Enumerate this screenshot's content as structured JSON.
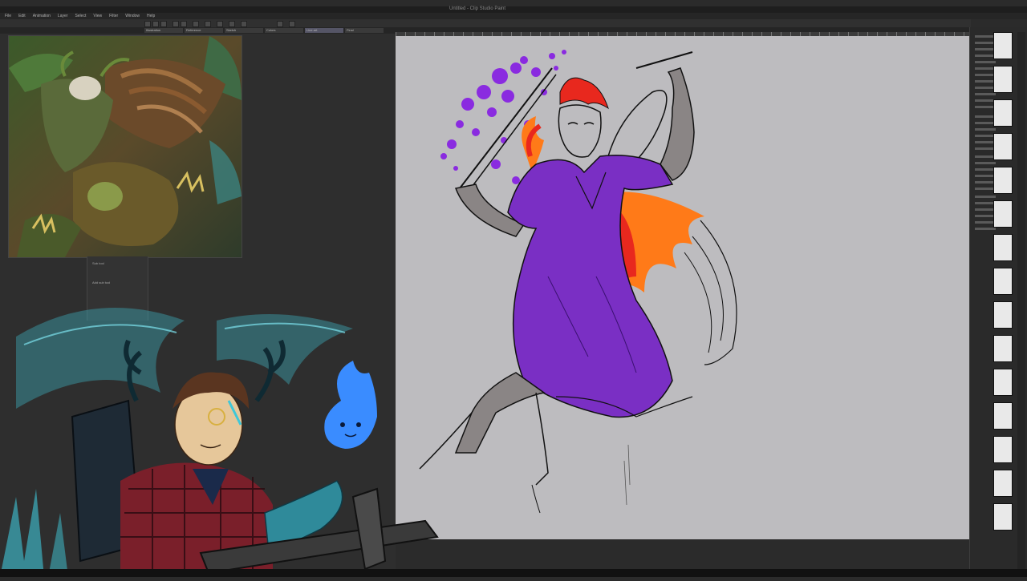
{
  "app": {
    "title": "Untitled - Clip Studio Paint"
  },
  "menu": [
    "File",
    "Edit",
    "Animation",
    "Layer",
    "Select",
    "View",
    "Filter",
    "Window",
    "Help"
  ],
  "tabs": [
    "Illustration",
    "Reference",
    "Sketch",
    "Colors",
    "Line art",
    "Final"
  ],
  "panels": {
    "sub_panel_title": "Sub tool",
    "sub_panel_item": "Add sub tool"
  },
  "colors": {
    "dress": "#7a2fc4",
    "hair": "#e8281e",
    "flame_orange": "#ff7a18",
    "splatter": "#8a2be0",
    "canvas": "#bdbcbf",
    "fire_spirit": "#3a8cff",
    "wing_teal": "#3fc7d8"
  },
  "icons": [
    "brush-icon",
    "eraser-icon",
    "layer-icon",
    "gear-icon"
  ]
}
